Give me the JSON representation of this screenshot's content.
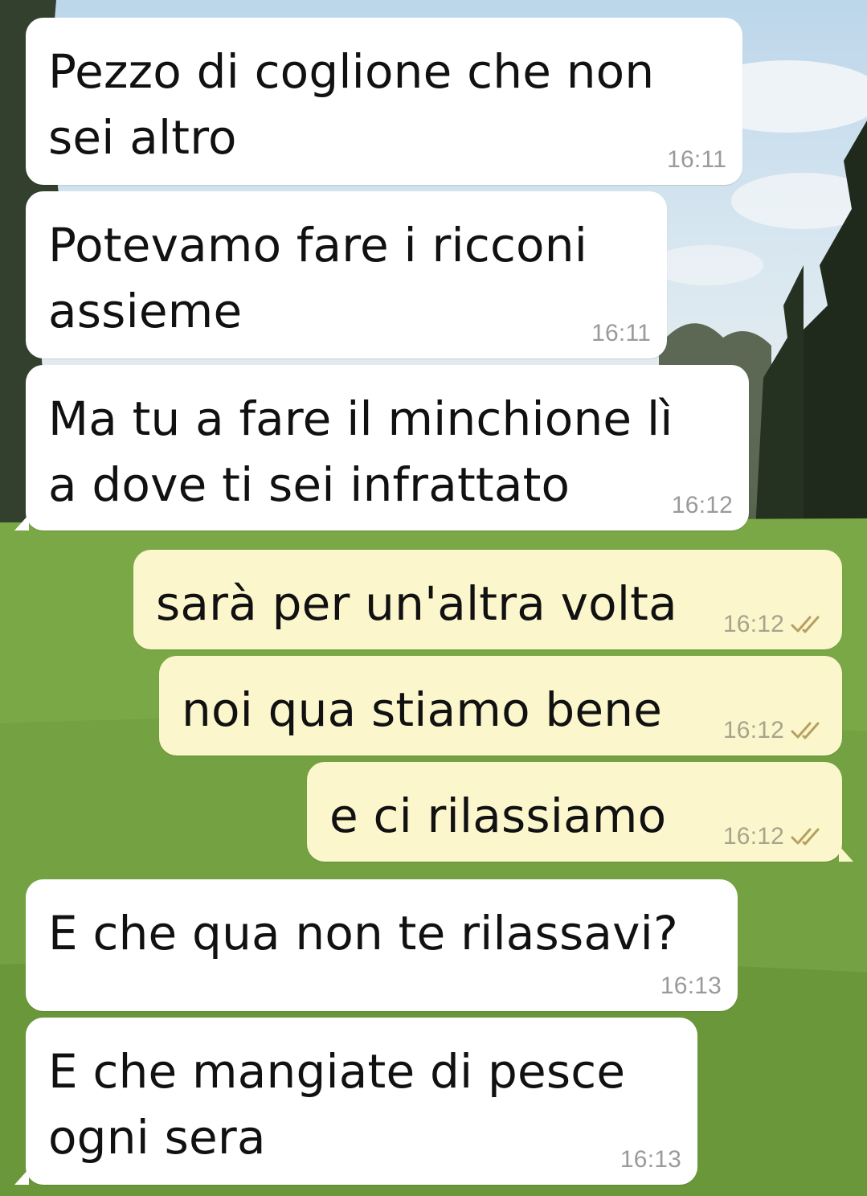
{
  "colors": {
    "incoming_bubble": "#ffffff",
    "outgoing_bubble": "#fbf6cc",
    "timestamp": "#9a9a9a",
    "read_ticks": "#b5a060"
  },
  "messages": [
    {
      "direction": "incoming",
      "text": "Pezzo di coglione che non\nsei altro",
      "time": "16:11"
    },
    {
      "direction": "incoming",
      "text": "Potevamo fare i ricconi\nassieme",
      "time": "16:11"
    },
    {
      "direction": "incoming",
      "text": "Ma tu a fare il minchione lì\na dove ti sei infrattato",
      "time": "16:12"
    },
    {
      "direction": "outgoing",
      "text": "sarà per un'altra volta",
      "time": "16:12",
      "status_icon": "double-check-icon"
    },
    {
      "direction": "outgoing",
      "text": "noi qua stiamo bene",
      "time": "16:12",
      "status_icon": "double-check-icon"
    },
    {
      "direction": "outgoing",
      "text": "e ci rilassiamo",
      "time": "16:12",
      "status_icon": "double-check-icon"
    },
    {
      "direction": "incoming",
      "text": "E che qua non te rilassavi?",
      "time": "16:13"
    },
    {
      "direction": "incoming",
      "text": "E che mangiate di pesce\nogni sera",
      "time": "16:13"
    }
  ]
}
